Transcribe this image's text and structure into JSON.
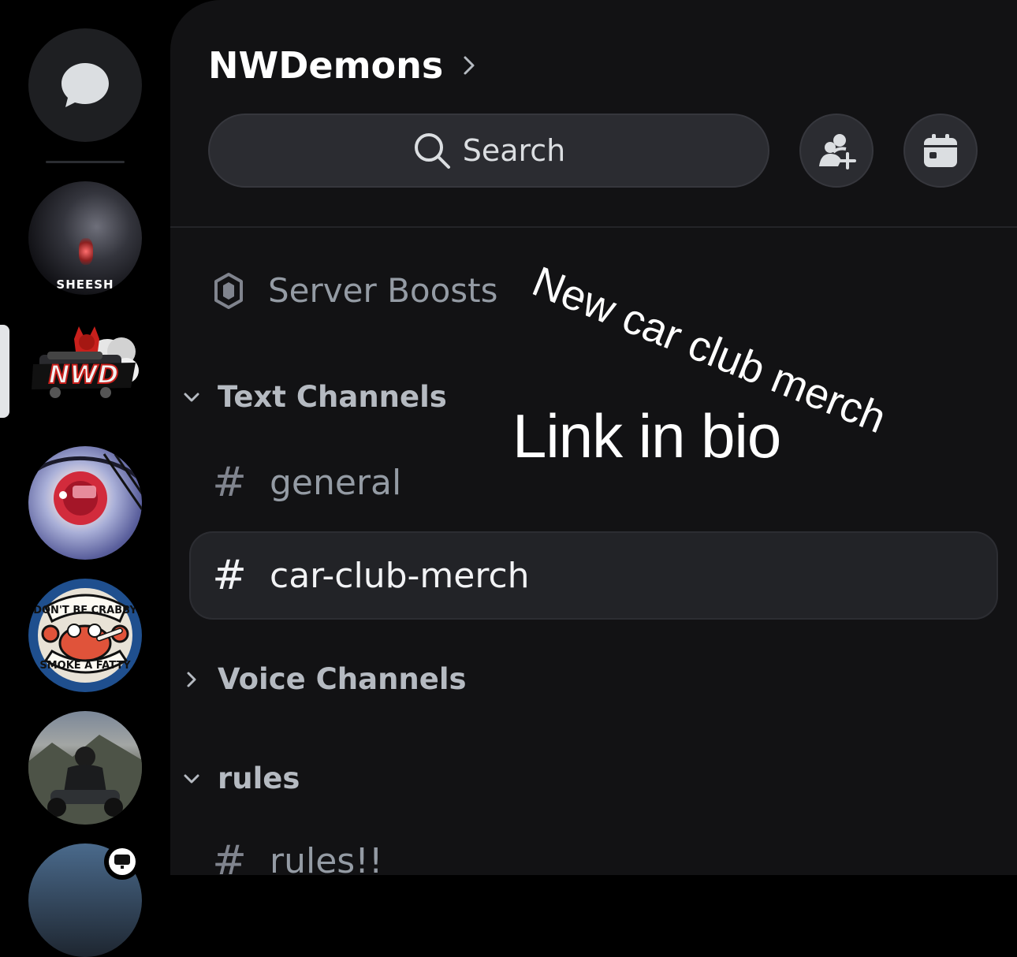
{
  "server": {
    "name": "NWDemons"
  },
  "header": {
    "search_label": "Search"
  },
  "rail": {
    "servers": [
      {
        "label": "SHEESH"
      },
      {
        "label": "NWD"
      },
      {
        "label": ""
      },
      {
        "label_top": "DON'T BE CRABBY",
        "label_bottom": "SMOKE A FATTY"
      },
      {
        "label": ""
      },
      {
        "label": ""
      }
    ]
  },
  "channels": {
    "boosts_label": "Server Boosts",
    "categories": [
      {
        "label": "Text Channels",
        "state": "expanded"
      },
      {
        "label": "Voice Channels",
        "state": "collapsed"
      },
      {
        "label": "rules",
        "state": "expanded"
      }
    ],
    "text": [
      {
        "name": "general",
        "selected": false
      },
      {
        "name": "car-club-merch",
        "selected": true
      }
    ],
    "rules": [
      {
        "name": "rules!!"
      }
    ]
  },
  "overlay": {
    "caption_1": "New car club merch",
    "caption_2": "Link in bio"
  },
  "colors": {
    "background": "#000000",
    "panel": "#121214",
    "selected_row": "#222327",
    "muted_text": "#949ba4"
  }
}
